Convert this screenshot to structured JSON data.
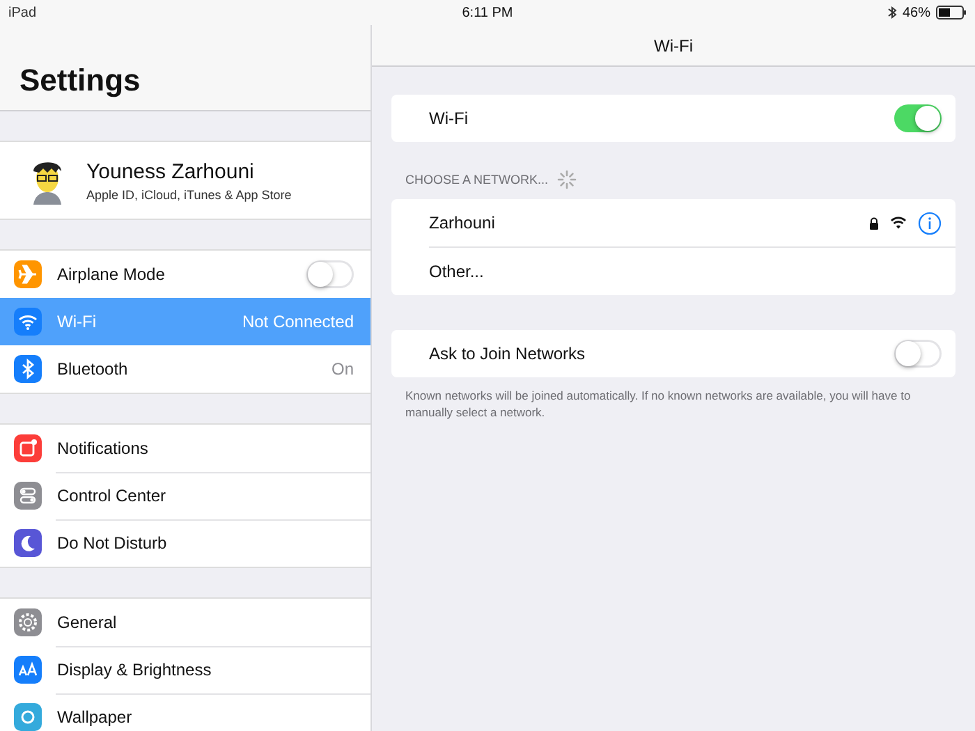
{
  "status_bar": {
    "device": "iPad",
    "time": "6:11 PM",
    "battery": "46%"
  },
  "sidebar": {
    "title": "Settings",
    "profile": {
      "name": "Youness Zarhouni",
      "subtitle": "Apple ID, iCloud, iTunes & App Store"
    },
    "groups": [
      [
        {
          "label": "Airplane Mode",
          "kind": "toggle",
          "on": false,
          "selected": false
        },
        {
          "label": "Wi-Fi",
          "kind": "value",
          "value": "Not Connected",
          "selected": true
        },
        {
          "label": "Bluetooth",
          "kind": "value",
          "value": "On",
          "selected": false
        }
      ],
      [
        {
          "label": "Notifications",
          "kind": "plain",
          "selected": false
        },
        {
          "label": "Control Center",
          "kind": "plain",
          "selected": false
        },
        {
          "label": "Do Not Disturb",
          "kind": "plain",
          "selected": false
        }
      ],
      [
        {
          "label": "General",
          "kind": "plain",
          "selected": false
        },
        {
          "label": "Display & Brightness",
          "kind": "plain",
          "selected": false
        },
        {
          "label": "Wallpaper",
          "kind": "plain",
          "selected": false
        }
      ]
    ]
  },
  "detail": {
    "title": "Wi-Fi",
    "wifi": {
      "label": "Wi-Fi",
      "on": true
    },
    "networks_header": "CHOOSE A NETWORK...",
    "networks": [
      {
        "name": "Zarhouni",
        "kind": "network",
        "locked": true
      },
      {
        "name": "Other...",
        "kind": "other"
      }
    ],
    "ask": {
      "label": "Ask to Join Networks",
      "on": false
    },
    "footer": "Known networks will be joined automatically. If no known networks are available, you will have to manually select a network."
  }
}
